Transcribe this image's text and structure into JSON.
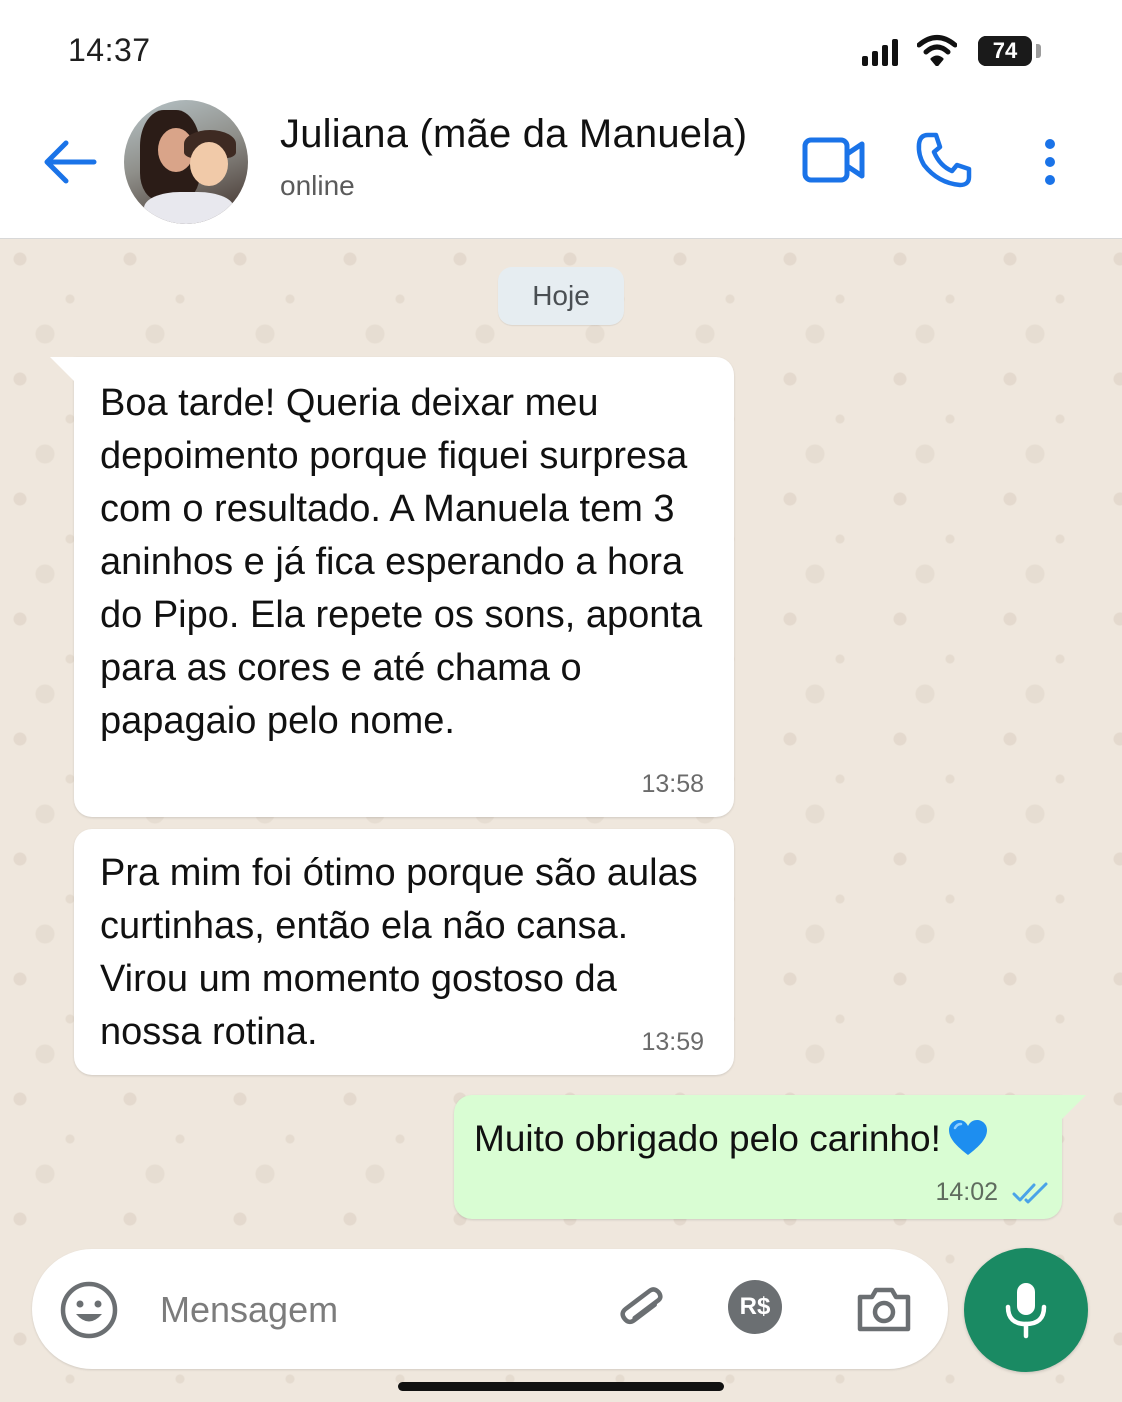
{
  "status_bar": {
    "time": "14:37",
    "battery": "74",
    "battery_level": 0.74
  },
  "header": {
    "contact_name": "Juliana (mãe da Manuela)",
    "contact_status": "online",
    "icons": [
      "back-arrow-icon",
      "video-call-icon",
      "phone-icon",
      "more-vertical-icon"
    ]
  },
  "chat": {
    "date_chip": "Hoje",
    "messages": [
      {
        "direction": "incoming",
        "text": "Boa tarde! Queria deixar meu depoimento porque fiquei surpresa com o resultado. A Manuela tem 3 aninhos e já fica esperando a hora do Pipo. Ela repete os sons, aponta para as cores e até chama o papagaio pelo nome.",
        "time": "13:58"
      },
      {
        "direction": "incoming",
        "text": "Pra mim foi ótimo porque são aulas curtinhas, então ela não cansa. Virou um momento gostoso da nossa rotina.",
        "time": "13:59"
      },
      {
        "direction": "outgoing",
        "text": "Muito obrigado pelo carinho!",
        "emoji": "blue-heart",
        "time": "14:02",
        "status": "read"
      }
    ]
  },
  "composer": {
    "placeholder": "Mensagem",
    "value": "",
    "payment_label": "R$",
    "icons": [
      "emoji-icon",
      "attachment-icon",
      "payment-icon",
      "camera-icon",
      "microphone-icon"
    ]
  },
  "colors": {
    "accent_blue": "#1a73e8",
    "outgoing_bubble": "#d9fdd3",
    "incoming_bubble": "#ffffff",
    "chat_background": "#efe7dd",
    "mic_button": "#1a8a63",
    "read_ticks": "#4aa3e8"
  }
}
